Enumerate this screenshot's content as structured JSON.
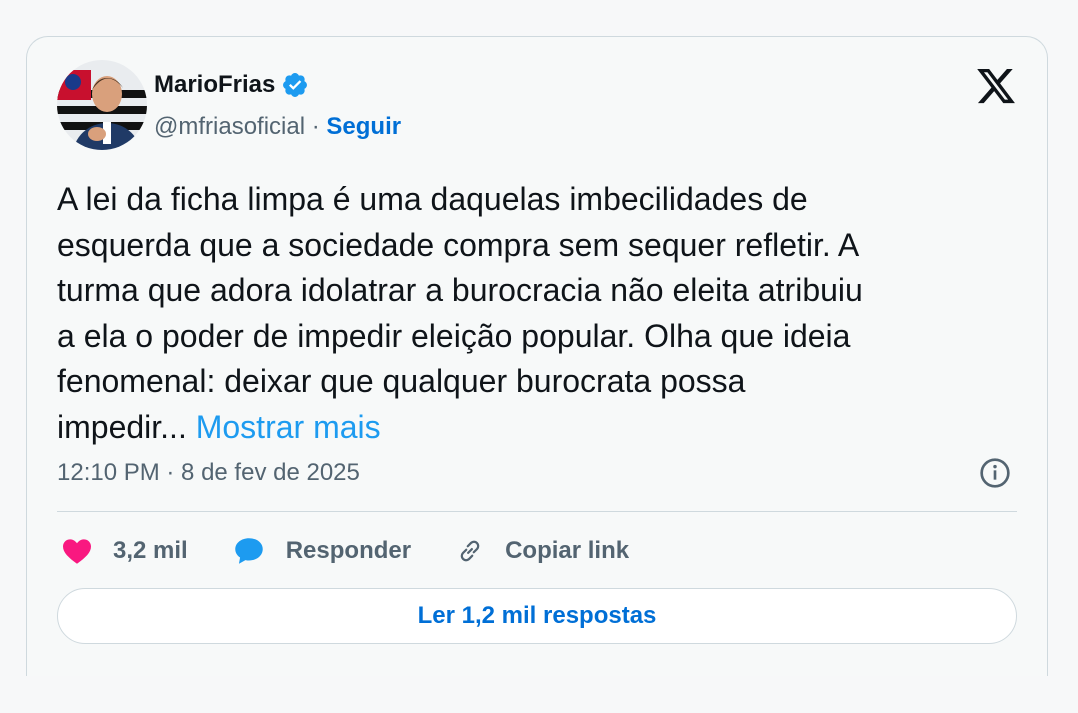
{
  "author": {
    "display_name": "MarioFrias",
    "handle": "@mfriasoficial",
    "separator": "·",
    "follow_label": "Seguir",
    "verified": true
  },
  "tweet": {
    "text": "A lei da ficha limpa é uma daquelas imbecilidades de\nesquerda que a sociedade compra sem sequer refletir. A\nturma que adora idolatrar a burocracia não eleita atribuiu\na ela o poder de impedir eleição popular. Olha que ideia\nfenomenal: deixar que qualquer burocrata possa\nimpedir... ",
    "show_more_label": "Mostrar mais",
    "timestamp": "12:10 PM · 8 de fev de 2025"
  },
  "actions": {
    "likes_label": "3,2 mil",
    "reply_label": "Responder",
    "copy_link_label": "Copiar link"
  },
  "read_replies_label": "Ler 1,2 mil respostas",
  "colors": {
    "accent": "#1d9bf0",
    "link_bold": "#006fd6",
    "like": "#f91880",
    "text": "#0f1419",
    "muted": "#536471",
    "border": "#cfd9de"
  },
  "icons": {
    "logo": "x-logo-icon",
    "verified": "verified-badge-icon",
    "info": "info-icon",
    "like": "heart-icon",
    "reply": "speech-bubble-icon",
    "copy_link": "link-icon"
  }
}
